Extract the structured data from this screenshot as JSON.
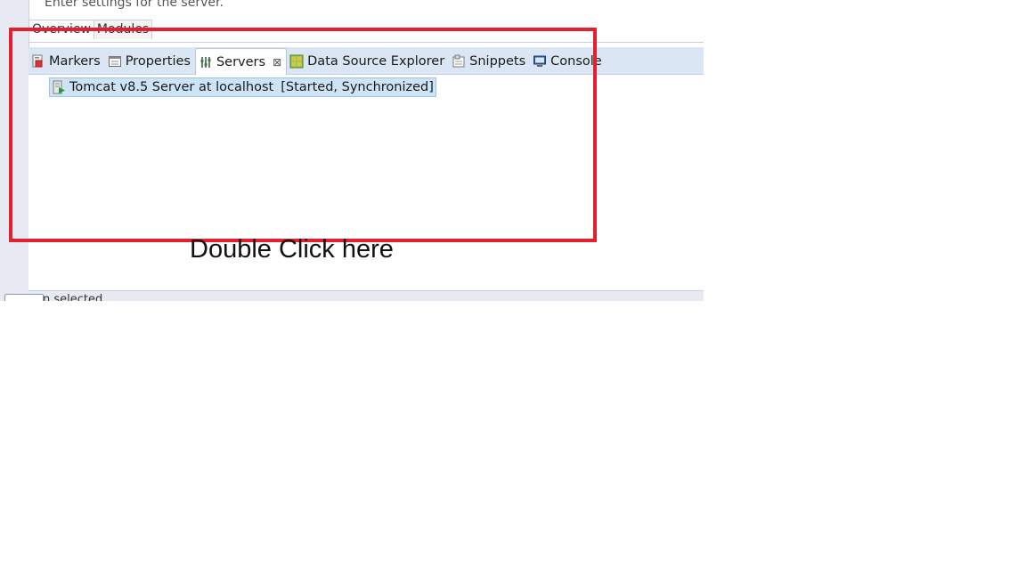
{
  "editor": {
    "hint": "Enter settings for the server.",
    "tabs": [
      "Overview",
      "Modules"
    ]
  },
  "view_tabs": [
    {
      "label": "Markers",
      "icon": "markers-icon"
    },
    {
      "label": "Properties",
      "icon": "properties-icon"
    },
    {
      "label": "Servers",
      "icon": "servers-icon",
      "active": true
    },
    {
      "label": "Data Source Explorer",
      "icon": "database-icon"
    },
    {
      "label": "Snippets",
      "icon": "snippets-icon"
    },
    {
      "label": "Console",
      "icon": "console-icon"
    }
  ],
  "servers": {
    "close_glyph": "⊠",
    "rows": [
      {
        "name": "Tomcat v8.5 Server at localhost",
        "state": "[Started, Synchronized]",
        "icon": "server-started-icon"
      }
    ]
  },
  "status": {
    "text": "n selected"
  },
  "annotation": {
    "text": "Double Click here",
    "box_color": "#e3202d"
  }
}
